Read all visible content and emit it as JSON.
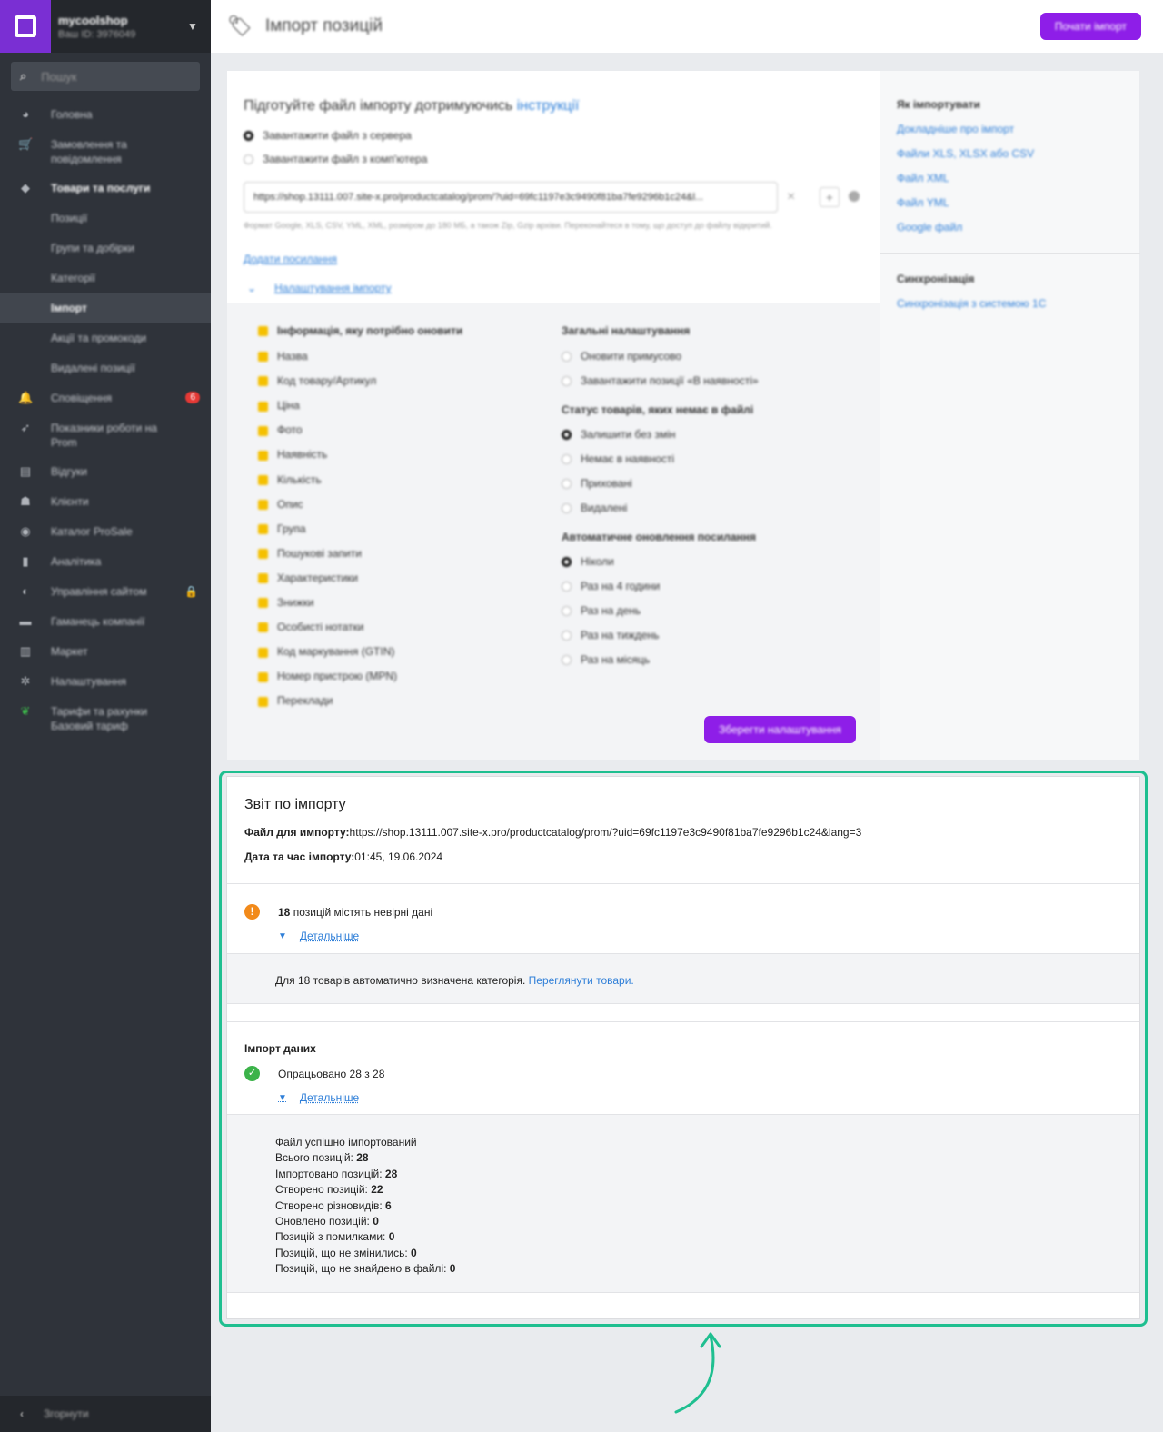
{
  "sidebar": {
    "shop_name": "mycoolshop",
    "shop_id": "Ваш ID: 3976049",
    "search_placeholder": "Пошук",
    "items": [
      {
        "label": "Головна",
        "icon": "dashboard-icon"
      },
      {
        "label": "Замовлення та повідомлення",
        "icon": "cart-icon"
      },
      {
        "label": "Товари та послуги",
        "icon": "tag-icon"
      },
      {
        "label": "Позиції",
        "sub": true
      },
      {
        "label": "Групи та добірки",
        "sub": true
      },
      {
        "label": "Категорії",
        "sub": true
      },
      {
        "label": "Імпорт",
        "sub": true,
        "active": true
      },
      {
        "label": "Акції та промокоди",
        "sub": true
      },
      {
        "label": "Видалені позиції",
        "sub": true
      },
      {
        "label": "Сповіщення",
        "icon": "bell-icon",
        "badge": "6"
      },
      {
        "label": "Показники роботи на Prom",
        "icon": "rocket-icon"
      },
      {
        "label": "Відгуки",
        "icon": "reviews-icon"
      },
      {
        "label": "Клієнти",
        "icon": "users-icon"
      },
      {
        "label": "Каталог ProSale",
        "icon": "globe-icon"
      },
      {
        "label": "Аналітика",
        "icon": "chart-icon"
      },
      {
        "label": "Управління сайтом",
        "icon": "site-icon",
        "lock": true
      },
      {
        "label": "Гаманець компанії",
        "icon": "wallet-icon"
      },
      {
        "label": "Маркет",
        "icon": "market-icon"
      },
      {
        "label": "Налаштування",
        "icon": "gear-icon"
      },
      {
        "label": "Тарифи та рахунки Базовий тариф",
        "icon": "leaf-icon"
      }
    ],
    "collapse_label": "Згорнути"
  },
  "header": {
    "title": "Імпорт позицій",
    "start_button": "Почати імпорт"
  },
  "settings": {
    "prepare_text": "Підготуйте файл імпорту дотримуючись",
    "prepare_link": "інструкції",
    "radio_server": "Завантажити файл з сервера",
    "radio_computer": "Завантажити файл з комп'ютера",
    "url_value": "https://shop.13111.007.site-x.pro/productcatalog/prom/?uid=69fc1197e3c9490f81ba7fe9296b1c24&l...",
    "hint": "Формат Google, XLS, CSV, YML, XML, розміром до 180 МБ, а також Zip, Gzip архіви. Переконайтеся в тому, що доступ до файлу відкритий.",
    "add_link": "Додати посилання",
    "settings_toggle": "Налаштування імпорту",
    "update_title": "Інформація, яку потрібно оновити",
    "update_fields": [
      "Назва",
      "Код товару/Артикул",
      "Ціна",
      "Фото",
      "Наявність",
      "Кількість",
      "Опис",
      "Група",
      "Пошукові запити",
      "Характеристики",
      "Знижки",
      "Особисті нотатки",
      "Код маркування (GTIN)",
      "Номер пристрою (MPN)",
      "Переклади"
    ],
    "general_title": "Загальні налаштування",
    "general_options": [
      "Оновити примусово",
      "Завантажити позиції «В наявності»"
    ],
    "status_title": "Статус товарів, яких немає в файлі",
    "status_options": [
      "Залишити без змін",
      "Немає в наявності",
      "Приховані",
      "Видалені"
    ],
    "auto_title": "Автоматичне оновлення посилання",
    "auto_options": [
      "Ніколи",
      "Раз на 4 години",
      "Раз на день",
      "Раз на тиждень",
      "Раз на місяць"
    ],
    "save_button": "Зберегти налаштування"
  },
  "info": {
    "how_title": "Як імпортувати",
    "how_links": [
      "Докладніше про імпорт",
      "Файли XLS, XLSX або CSV",
      "Файл XML",
      "Файл YML",
      "Google файл"
    ],
    "sync_title": "Синхронізація",
    "sync_link": "Синхронізація з системою 1С"
  },
  "report": {
    "title": "Звіт по імпорту",
    "file_label": "Файл для импорту:",
    "file_value": "https://shop.13111.007.site-x.pro/productcatalog/prom/?uid=69fc1197e3c9490f81ba7fe9296b1c24&lang=3",
    "date_label": "Дата та час імпорту:",
    "date_value": "01:45, 19.06.2024",
    "warning_count": "18",
    "warning_text": "позицій містять невірні дані",
    "details_label": "Детальніше",
    "note_text": "Для 18 товарів автоматично визначена категорія.",
    "note_link": "Переглянути товари.",
    "import_title": "Імпорт даних",
    "processed_text": "Опрацьовано 28 з 28",
    "details_label_2": "Детальніше",
    "success_text": "Файл успішно імпортований",
    "stats": [
      {
        "label": "Всього позицій: ",
        "value": "28"
      },
      {
        "label": "Імпортовано позицій: ",
        "value": "28"
      },
      {
        "label": "Створено позицій: ",
        "value": "22"
      },
      {
        "label": "Створено різновидів: ",
        "value": "6"
      },
      {
        "label": "Оновлено позицій: ",
        "value": "0"
      },
      {
        "label": "Позицій з помилками: ",
        "value": "0"
      },
      {
        "label": "Позицій, що не змінились: ",
        "value": "0"
      },
      {
        "label": "Позицій, що не знайдено в файлі: ",
        "value": "0"
      }
    ]
  },
  "colors": {
    "accent": "#8e1ee8",
    "highlight": "#1fbf90",
    "link": "#2f7fd8",
    "warning": "#f28a1a",
    "success": "#3cb34a"
  }
}
